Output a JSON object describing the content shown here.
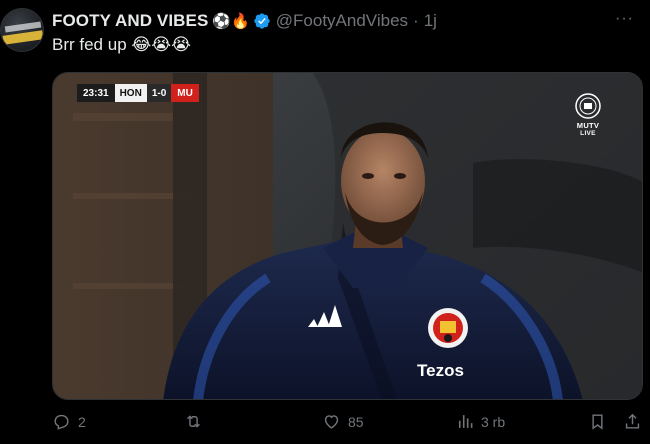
{
  "tweet": {
    "display_name": "FOOTY AND VIBES",
    "name_emojis": "⚽🔥",
    "handle": "@FootyAndVibes",
    "separator": "·",
    "time": "1j",
    "text": "Brr fed up 😂😭😭",
    "more_label": "···"
  },
  "video": {
    "scoreboard": {
      "clock": "23:31",
      "home": "HON",
      "score": "1-0",
      "away": "MU"
    },
    "watermark": {
      "brand": "MUTV",
      "live": "LIVE"
    },
    "sponsor": "Tezos"
  },
  "actions": {
    "replies": "2",
    "reposts": "",
    "likes": "85",
    "views": "3 rb"
  },
  "colors": {
    "background": "#000000",
    "text": "#e7e9ea",
    "secondary": "#71767b",
    "verified": "#1d9bf0",
    "away_badge": "#d0211c"
  },
  "icons": [
    "verified-badge-icon",
    "more-icon",
    "reply-icon",
    "repost-icon",
    "like-icon",
    "views-icon",
    "bookmark-icon",
    "share-icon"
  ]
}
